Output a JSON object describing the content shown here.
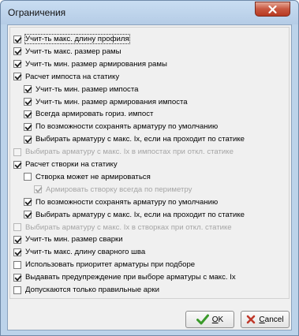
{
  "window": {
    "title": "Ограничения"
  },
  "checkboxes": [
    {
      "label": "Учит-ть макс. длину профиля",
      "checked": true,
      "enabled": true,
      "level": 0,
      "focused": true
    },
    {
      "label": "Учит-ть макс. размер рамы",
      "checked": true,
      "enabled": true,
      "level": 0
    },
    {
      "label": "Учит-ть мин. размер армирования рамы",
      "checked": true,
      "enabled": true,
      "level": 0
    },
    {
      "label": "Расчет импоста на статику",
      "checked": true,
      "enabled": true,
      "level": 0
    },
    {
      "label": "Учит-ть мин. размер импоста",
      "checked": true,
      "enabled": true,
      "level": 1
    },
    {
      "label": "Учит-ть мин. размер армирования импоста",
      "checked": true,
      "enabled": true,
      "level": 1
    },
    {
      "label": "Всегда армировать гориз. импост",
      "checked": true,
      "enabled": true,
      "level": 1
    },
    {
      "label": "По возможности сохранять арматуру по умолчанию",
      "checked": true,
      "enabled": true,
      "level": 1
    },
    {
      "label": "Выбирать арматуру с макс. Ix, если на проходит по статике",
      "checked": true,
      "enabled": true,
      "level": 1
    },
    {
      "label": "Выбирать арматуру с макс. Ix в импостах при откл. статике",
      "checked": false,
      "enabled": false,
      "level": 0
    },
    {
      "label": "Расчет створки на статику",
      "checked": true,
      "enabled": true,
      "level": 0
    },
    {
      "label": "Створка может не армироваться",
      "checked": false,
      "enabled": true,
      "level": 1
    },
    {
      "label": "Армировать створку всегда по периметру",
      "checked": true,
      "enabled": false,
      "level": 2
    },
    {
      "label": "По возможности сохранять арматуру по умолчанию",
      "checked": true,
      "enabled": true,
      "level": 1
    },
    {
      "label": "Выбирать арматуру с макс. Ix, если на проходит по статике",
      "checked": true,
      "enabled": true,
      "level": 1
    },
    {
      "label": "Выбирать арматуру с макс. Ix в створках при откл. статике",
      "checked": false,
      "enabled": false,
      "level": 0
    },
    {
      "label": "Учит-ть мин. размер сварки",
      "checked": true,
      "enabled": true,
      "level": 0
    },
    {
      "label": "Учит-ть макс. длину сварного шва",
      "checked": true,
      "enabled": true,
      "level": 0
    },
    {
      "label": "Использовать приоритет арматуры при подборе",
      "checked": false,
      "enabled": true,
      "level": 0
    },
    {
      "label": "Выдавать предупреждение при выборе арматуры с макс. Ix",
      "checked": true,
      "enabled": true,
      "level": 0
    },
    {
      "label": "Допускаются только правильные арки",
      "checked": false,
      "enabled": true,
      "level": 0
    }
  ],
  "buttons": {
    "ok_label": "OK",
    "ok_mnemonic": "O",
    "ok_rest": "K",
    "cancel_label": "Cancel",
    "cancel_mnemonic": "C",
    "cancel_rest": "ancel"
  },
  "icons": {
    "close": "close-icon",
    "ok": "checkmark-icon",
    "cancel": "cross-icon"
  },
  "colors": {
    "title_bar": "#bcd3ea",
    "close_button": "#c8573f",
    "ok_check": "#3a9a2a",
    "cancel_cross": "#c0392b",
    "disabled_text": "#a5a5a5"
  }
}
